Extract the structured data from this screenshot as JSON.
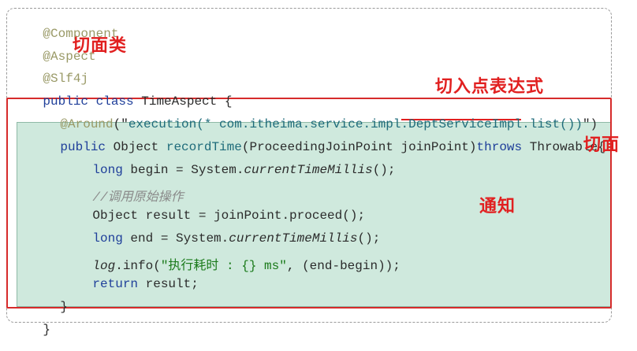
{
  "code": {
    "l1": "@Component",
    "l2": "@Aspect",
    "l3": "@Slf4j",
    "l4a": "public class ",
    "l4b": "TimeAspect {",
    "l5a": "@Around",
    "l5b": "(\"",
    "l5c": "execution(* com.itheima.service.impl.",
    "l5d": "DeptServiceImpl",
    "l5e": ".list())",
    "l5f": "\")",
    "l6a": "public ",
    "l6b": "Object ",
    "l6c": "recordTime",
    "l6d": "(ProceedingJoinPoint joinPoint)",
    "l6e": "throws ",
    "l6f": "Throwable{",
    "l7a": "long ",
    "l7b": "begin = System.",
    "l7c": "currentTimeMillis",
    "l7d": "();",
    "l8": "//调用原始操作",
    "l9": "Object result = joinPoint.proceed();",
    "l10a": "long ",
    "l10b": "end = System.",
    "l10c": "currentTimeMillis",
    "l10d": "();",
    "l11a": "log",
    "l11b": ".info(",
    "l11c": "\"执行耗时 : {} ms\"",
    "l11d": ", (end-begin));",
    "l12a": "return ",
    "l12b": "result;",
    "l13": "}",
    "l14": "}"
  },
  "labels": {
    "aspect_class": "切面类",
    "pointcut_expression": "切入点表达式",
    "aspect": "切面",
    "advice": "通知"
  },
  "colors": {
    "annotation_red": "#e12020",
    "box_border": "#d62b2b",
    "advice_bg": "#cfe9dd"
  }
}
